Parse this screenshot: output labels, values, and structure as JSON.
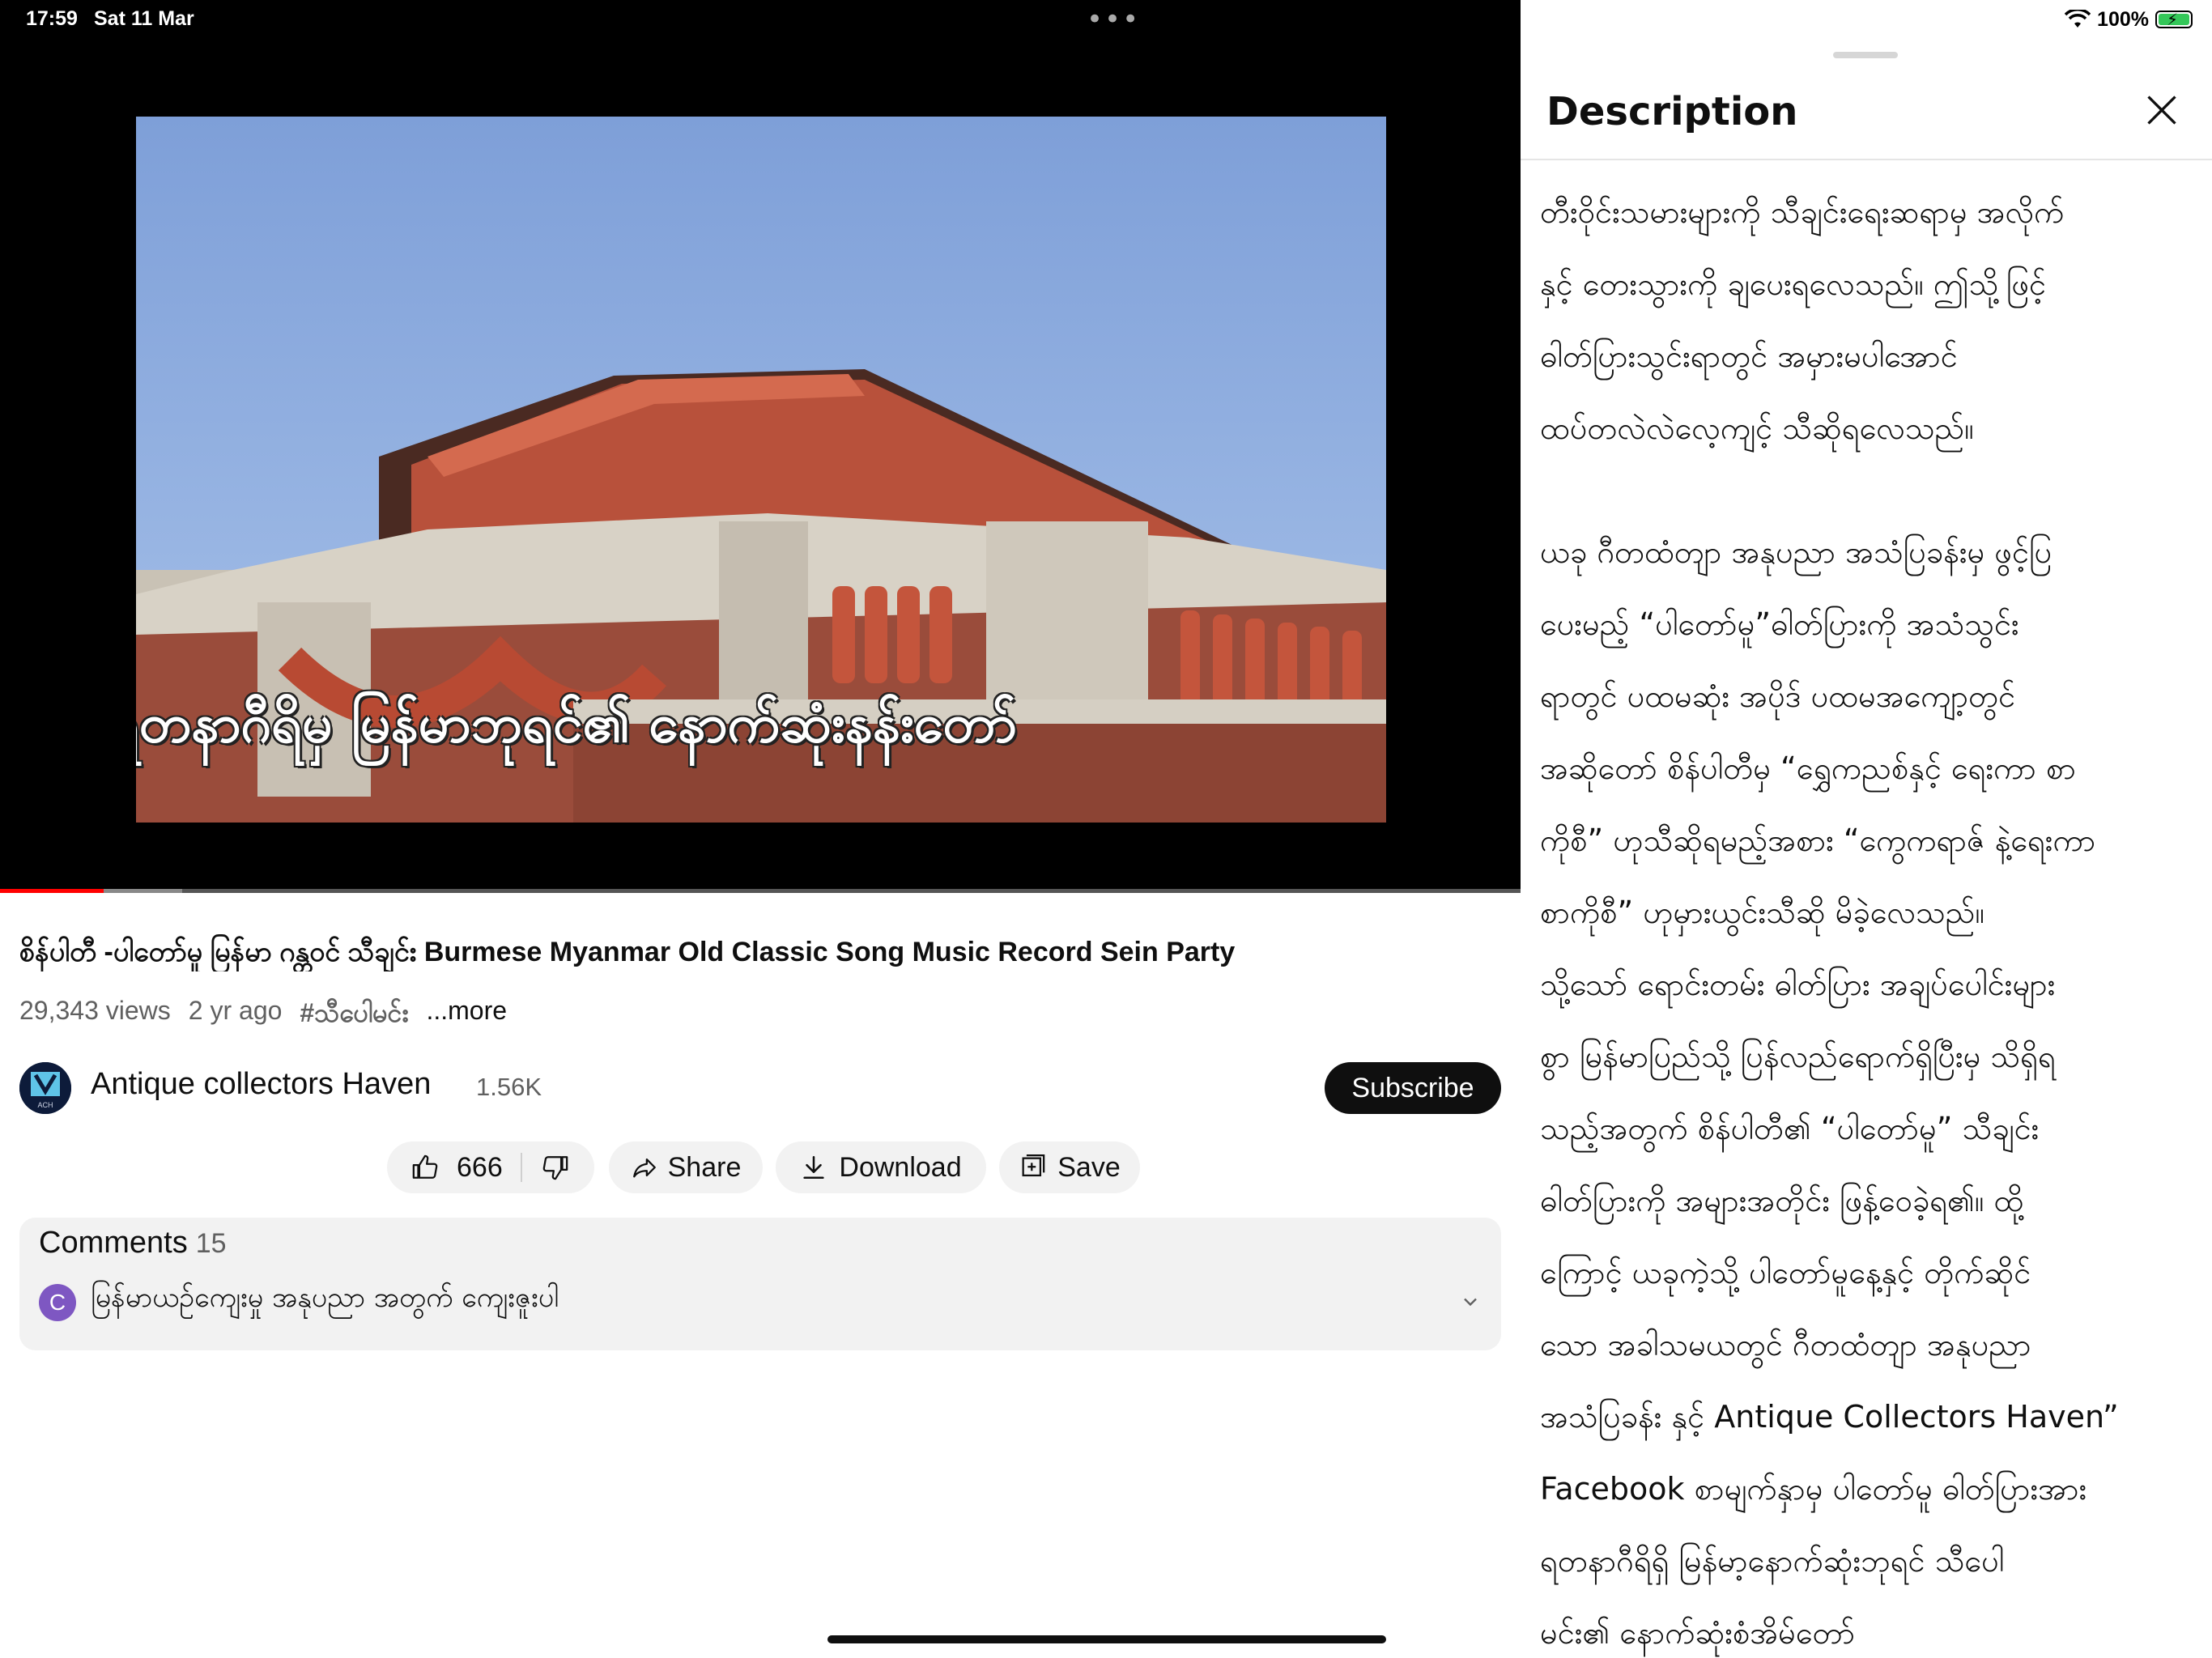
{
  "status_bar": {
    "time": "17:59",
    "date": "Sat 11 Mar",
    "battery": "100%"
  },
  "video": {
    "subtitle_text": "ရတနာဂီရိမှ မြန်မာဘုရင်၏ နောက်ဆုံးနန်းတော်",
    "progress": 0.068,
    "buffered": 0.12
  },
  "title": "စိန်ပါတီ -ပါတော်မူ မြန်မာ ဂန္တဝင် သီချင်း  Burmese Myanmar Old Classic Song Music Record Sein Party",
  "meta": {
    "views": "29,343 views",
    "age": "2 yr ago",
    "hashtag": "#သီပေါမင်း",
    "more": "...more"
  },
  "channel": {
    "name": "Antique collectors Haven",
    "subscribers": "1.56K",
    "subscribe_label": "Subscribe",
    "avatar_text": "ACH"
  },
  "actions": {
    "likes": "666",
    "share": "Share",
    "download": "Download",
    "save": "Save"
  },
  "comments": {
    "label": "Comments",
    "count": "15",
    "author_initial": "C",
    "top_comment": "မြန်မာယဥ်ကျေးမှု အနုပညာ အတွက် ကျေးဇူးပါ"
  },
  "description": {
    "heading": "Description",
    "lines": [
      "တီးဝိုင်းသမားများကို သီချင်းရေးဆရာမှ အလိုက်",
      "နှင့် တေးသွားကို ချပေးရလေသည်။ ဤသို့ဖြင့်",
      "ဓါတ်ပြားသွင်းရာတွင် အမှားမပါအောင်",
      "ထပ်တလဲလဲလေ့ကျင့် သီဆိုရလေသည်။",
      "",
      "ယခု ဂီတထံတျာ အနုပညာ အသံပြခန်းမှ ဖွင့်ပြ",
      "ပေးမည့် “ပါတော်မူ”ဓါတ်ပြားကို အသံသွင်း",
      "ရာတွင် ပထမဆုံး အပိုဒ် ပထမအကျော့တွင်",
      "အဆိုတော် စိန်ပါတီမှ “ရွှေကညစ်နှင့် ရေးကာ စာ",
      "ကိုစီ” ဟုသီဆိုရမည့်အစား “ကွေကရာဇ် နဲ့ရေးကာ",
      "စာကိုစီ” ဟုမှားယွင်းသီဆို မိခဲ့လေသည်။",
      "သို့သော် ရောင်းတမ်း ဓါတ်ပြား အချပ်ပေါင်းများ",
      "စွာ မြန်မာပြည်သို့ ပြန်လည်ရောက်ရှိပြီးမှ သိရှိရ",
      "သည့်အတွက် စိန်ပါတီ၏ “ပါတော်မူ” သီချင်း",
      "ဓါတ်ပြားကို အများအတိုင်း ဖြန့်ဝေခဲ့ရ၏။  ထို့",
      "ကြောင့် ယခုကဲ့သို့ ပါတော်မူနေ့နှင့် တိုက်ဆိုင်",
      "သော အခါသမယတွင် ဂီတထံတျာ အနုပညာ",
      "အသံပြခန်း နှင့် Antique Collectors Haven”",
      "Facebook စာမျက်နှာမှ ပါတော်မူ ဓါတ်ပြားအား",
      "ရတနာဂီရိရှိ မြန်မာ့နောက်ဆုံးဘုရင် သီပေါ",
      "မင်း၏ နောက်ဆုံးစံအိမ်တော်"
    ]
  },
  "colors": {
    "accent": "#ff0000",
    "pill_bg": "#f2f2f2",
    "text": "#0f0f0f",
    "muted": "#606060"
  },
  "icons": [
    "wifi-icon",
    "battery-icon",
    "more-dots-icon",
    "thumbs-up-icon",
    "thumbs-down-icon",
    "share-icon",
    "download-icon",
    "save-icon",
    "close-icon",
    "chevron-down-icon"
  ]
}
